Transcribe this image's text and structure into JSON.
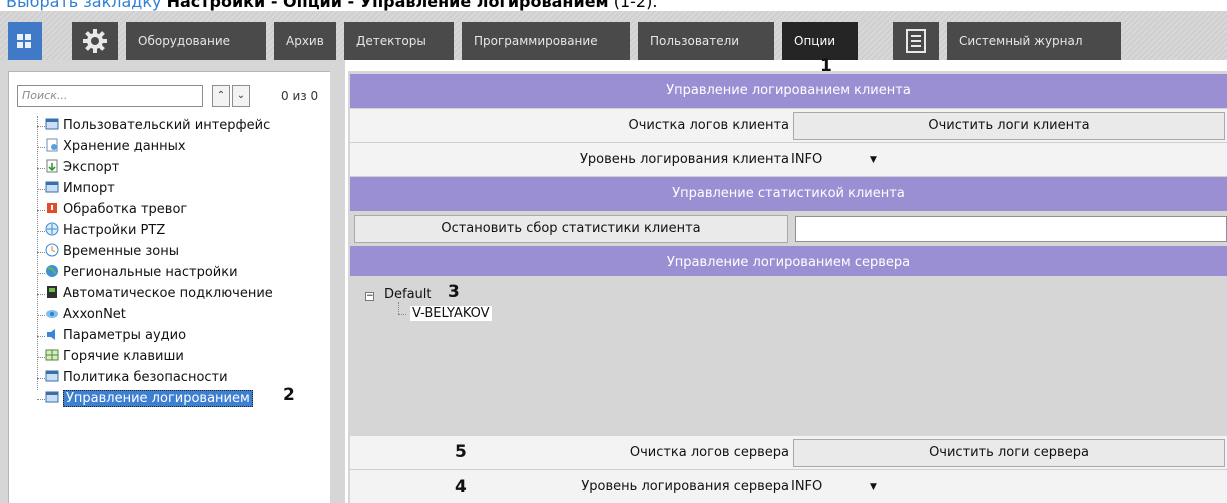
{
  "instruction": {
    "link_text": "Выбрать закладку",
    "bold_path": "Настройки - Опции - Управление логированием",
    "tail": " (1-2)."
  },
  "topbar": {
    "tabs": [
      {
        "label": "Оборудование"
      },
      {
        "label": "Архив"
      },
      {
        "label": "Детекторы"
      },
      {
        "label": "Программирование"
      },
      {
        "label": "Пользователи"
      },
      {
        "label": "Опции"
      },
      {
        "label": "Системный журнал"
      }
    ],
    "active_tab": "Опции"
  },
  "left": {
    "search": {
      "placeholder": "Поиск...",
      "count": "0 из 0"
    },
    "items": [
      {
        "label": "Пользовательский интерфейс"
      },
      {
        "label": "Хранение данных"
      },
      {
        "label": "Экспорт"
      },
      {
        "label": "Импорт"
      },
      {
        "label": "Обработка тревог"
      },
      {
        "label": "Настройки PTZ"
      },
      {
        "label": "Временные зоны"
      },
      {
        "label": "Региональные настройки"
      },
      {
        "label": "Автоматическое подключение"
      },
      {
        "label": "AxxonNet"
      },
      {
        "label": "Параметры аудио"
      },
      {
        "label": "Горячие клавиши"
      },
      {
        "label": "Политика безопасности"
      },
      {
        "label": "Управление логированием"
      }
    ]
  },
  "markers": {
    "m1": "1",
    "m2": "2",
    "m3": "3",
    "m4": "4",
    "m5": "5"
  },
  "right": {
    "client_logging_header": "Управление логированием клиента",
    "clear_client_logs_label": "Очистка логов клиента",
    "clear_client_logs_button": "Очистить логи клиента",
    "client_log_level_label": "Уровень логирования клиента",
    "client_log_level_value": "INFO",
    "client_stats_header": "Управление статистикой клиента",
    "stop_stats_button": "Остановить сбор статистики клиента",
    "stats_path_value": "",
    "server_logging_header": "Управление логированием сервера",
    "server_tree": {
      "root": "Default",
      "child": "V-BELYAKOV"
    },
    "clear_server_logs_label": "Очистка логов сервера",
    "clear_server_logs_button": "Очистить логи сервера",
    "server_log_level_label": "Уровень логирования сервера",
    "server_log_level_value": "INFO"
  },
  "colors": {
    "header_bg": "#9b8fd4",
    "active_tab_bg": "#252525",
    "tab_bg": "#4a4a4a",
    "selection": "#3d7fd0",
    "home_tile": "#3f79c8"
  }
}
